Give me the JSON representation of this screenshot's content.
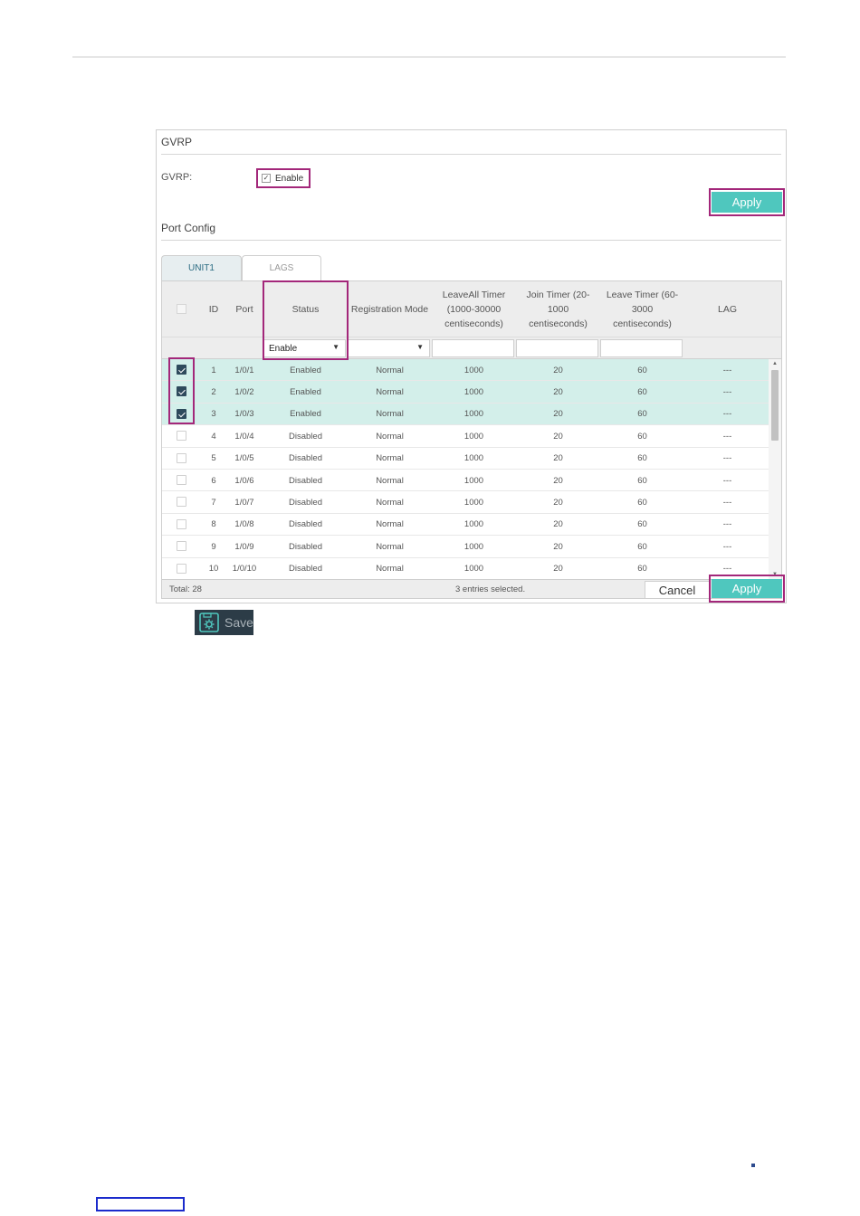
{
  "gvrp_panel": {
    "title": "GVRP",
    "label": "GVRP:",
    "enable_label": "Enable",
    "enable_checked": true,
    "apply_label": "Apply"
  },
  "port_config": {
    "title": "Port Config",
    "tabs": [
      {
        "label": "UNIT1",
        "active": true
      },
      {
        "label": "LAGS",
        "active": false
      }
    ],
    "columns": [
      "ID",
      "Port",
      "Status",
      "Registration Mode",
      "LeaveAll Timer (1000-30000 centiseconds)",
      "Join Timer (20-1000 centiseconds)",
      "Leave Timer (60-3000 centiseconds)",
      "LAG"
    ],
    "filter": {
      "status_value": "Enable",
      "registration_value": "",
      "leaveall_value": "",
      "join_value": "",
      "leave_value": ""
    },
    "rows": [
      {
        "checked": true,
        "id": "1",
        "port": "1/0/1",
        "status": "Enabled",
        "mode": "Normal",
        "leaveall": "1000",
        "join": "20",
        "leave": "60",
        "lag": "---"
      },
      {
        "checked": true,
        "id": "2",
        "port": "1/0/2",
        "status": "Enabled",
        "mode": "Normal",
        "leaveall": "1000",
        "join": "20",
        "leave": "60",
        "lag": "---"
      },
      {
        "checked": true,
        "id": "3",
        "port": "1/0/3",
        "status": "Enabled",
        "mode": "Normal",
        "leaveall": "1000",
        "join": "20",
        "leave": "60",
        "lag": "---"
      },
      {
        "checked": false,
        "id": "4",
        "port": "1/0/4",
        "status": "Disabled",
        "mode": "Normal",
        "leaveall": "1000",
        "join": "20",
        "leave": "60",
        "lag": "---"
      },
      {
        "checked": false,
        "id": "5",
        "port": "1/0/5",
        "status": "Disabled",
        "mode": "Normal",
        "leaveall": "1000",
        "join": "20",
        "leave": "60",
        "lag": "---"
      },
      {
        "checked": false,
        "id": "6",
        "port": "1/0/6",
        "status": "Disabled",
        "mode": "Normal",
        "leaveall": "1000",
        "join": "20",
        "leave": "60",
        "lag": "---"
      },
      {
        "checked": false,
        "id": "7",
        "port": "1/0/7",
        "status": "Disabled",
        "mode": "Normal",
        "leaveall": "1000",
        "join": "20",
        "leave": "60",
        "lag": "---"
      },
      {
        "checked": false,
        "id": "8",
        "port": "1/0/8",
        "status": "Disabled",
        "mode": "Normal",
        "leaveall": "1000",
        "join": "20",
        "leave": "60",
        "lag": "---"
      },
      {
        "checked": false,
        "id": "9",
        "port": "1/0/9",
        "status": "Disabled",
        "mode": "Normal",
        "leaveall": "1000",
        "join": "20",
        "leave": "60",
        "lag": "---"
      },
      {
        "checked": false,
        "id": "10",
        "port": "1/0/10",
        "status": "Disabled",
        "mode": "Normal",
        "leaveall": "1000",
        "join": "20",
        "leave": "60",
        "lag": "---"
      }
    ],
    "footer": {
      "total": "Total: 28",
      "selected": "3 entries selected.",
      "cancel_label": "Cancel",
      "apply_label": "Apply"
    }
  },
  "save_button": {
    "label": "Save",
    "icon": "gear-save-icon"
  },
  "colors": {
    "accent": "#4fc7be",
    "highlight": "#a3277a",
    "selected_row": "#d3efea",
    "checkbox_checked": "#2e4a5c"
  }
}
